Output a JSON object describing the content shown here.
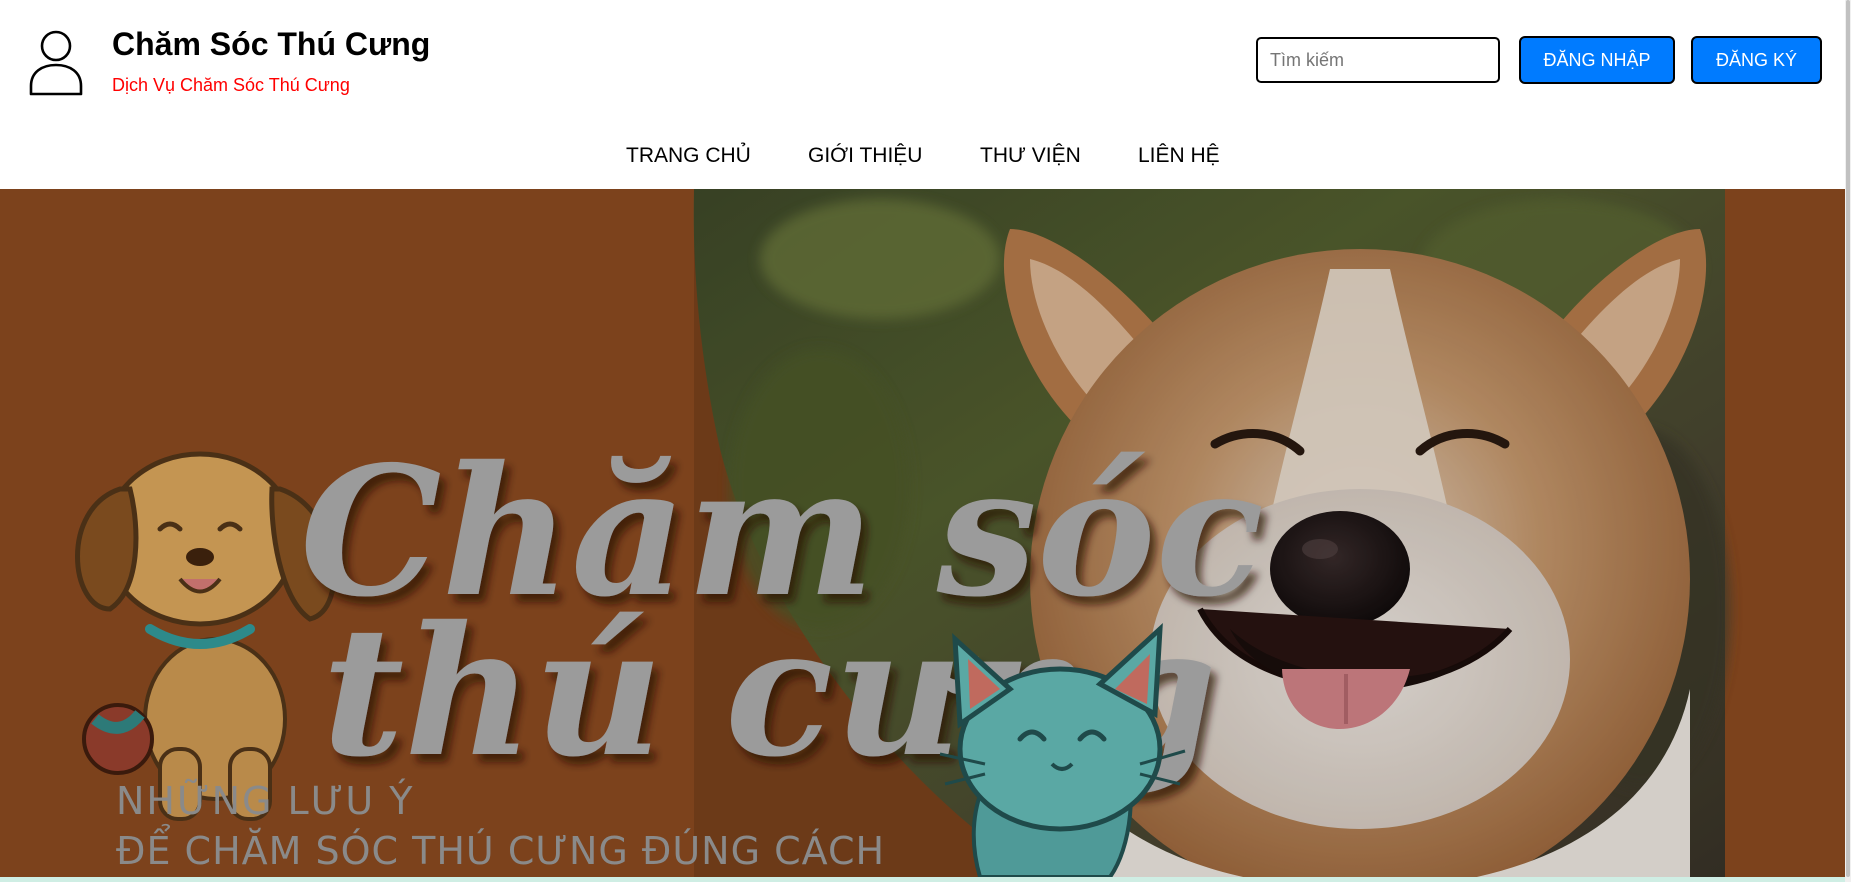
{
  "header": {
    "title": "Chăm Sóc Thú Cưng",
    "subtitle": "Dịch Vụ Chăm Sóc Thú Cưng",
    "search_placeholder": "Tìm kiếm",
    "login_label": "ĐĂNG NHẬP",
    "register_label": "ĐĂNG KÝ",
    "avatar_icon": "user-icon"
  },
  "nav": {
    "items": [
      {
        "label": "TRANG CHỦ"
      },
      {
        "label": "GIỚI THIỆU"
      },
      {
        "label": "THƯ VIỆN"
      },
      {
        "label": "LIÊN HỆ"
      }
    ]
  },
  "hero": {
    "headline_line1": "Chăm sóc",
    "headline_line2": "thú cưng",
    "caption_line1": "NHỮNG LƯU Ý",
    "caption_line2": "ĐỂ CHĂM SÓC THÚ CƯNG ĐÚNG CÁCH"
  },
  "colors": {
    "brand_button": "#007bff",
    "subtitle_red": "#ff0000",
    "hero_background": "#7c421c"
  }
}
